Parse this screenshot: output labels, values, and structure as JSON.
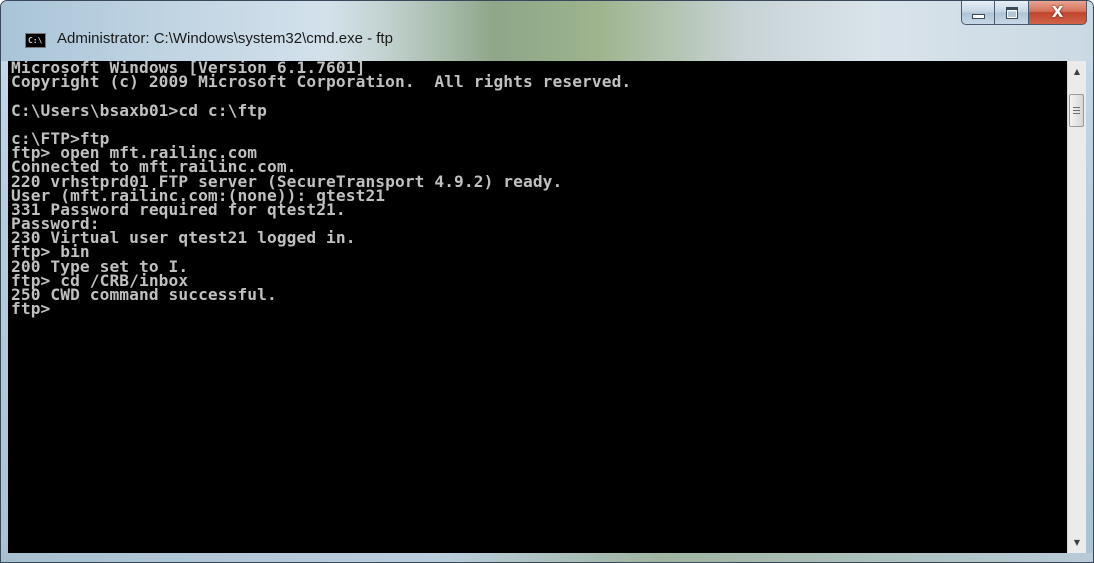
{
  "window": {
    "title": "Administrator: C:\\Windows\\system32\\cmd.exe - ftp",
    "icon": "cmd-icon",
    "icon_label": "C:\\",
    "buttons": {
      "minimize_icon": "minimize-icon",
      "maximize_icon": "maximize-icon",
      "close_icon": "close-icon",
      "close_glyph": "X"
    }
  },
  "console": {
    "background": "#000000",
    "foreground": "#c0c0c0",
    "lines": [
      "Microsoft Windows [Version 6.1.7601]",
      "Copyright (c) 2009 Microsoft Corporation.  All rights reserved.",
      "",
      "C:\\Users\\bsaxb01>cd c:\\ftp",
      "",
      "c:\\FTP>ftp",
      "ftp> open mft.railinc.com",
      "Connected to mft.railinc.com.",
      "220 vrhstprd01 FTP server (SecureTransport 4.9.2) ready.",
      "User (mft.railinc.com:(none)): qtest21",
      "331 Password required for qtest21.",
      "Password:",
      "230 Virtual user qtest21 logged in.",
      "ftp> bin",
      "200 Type set to I.",
      "ftp> cd /CRB/inbox",
      "250 CWD command successful.",
      "ftp>"
    ]
  },
  "scrollbar": {
    "up_glyph": "▲",
    "down_glyph": "▼"
  }
}
